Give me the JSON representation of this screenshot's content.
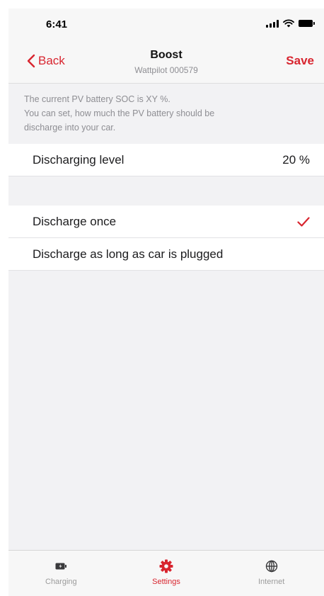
{
  "status_bar": {
    "time": "6:41"
  },
  "nav": {
    "back_label": "Back",
    "title": "Boost",
    "subtitle": "Wattpilot 000579",
    "save_label": "Save"
  },
  "info": {
    "line1": "The current PV battery SOC is XY %.",
    "line2": "You can set, how much the PV battery should be",
    "line3": "discharge into your car."
  },
  "discharging_level": {
    "label": "Discharging level",
    "value": "20 %"
  },
  "options": [
    {
      "label": "Discharge once",
      "selected": true
    },
    {
      "label": "Discharge as long as car is plugged",
      "selected": false
    }
  ],
  "tabs": [
    {
      "label": "Charging",
      "icon": "battery-icon",
      "active": false
    },
    {
      "label": "Settings",
      "icon": "gear-icon",
      "active": true
    },
    {
      "label": "Internet",
      "icon": "globe-icon",
      "active": false
    }
  ],
  "colors": {
    "accent": "#d8252f",
    "muted": "#8e8e93",
    "background": "#f2f2f4"
  }
}
